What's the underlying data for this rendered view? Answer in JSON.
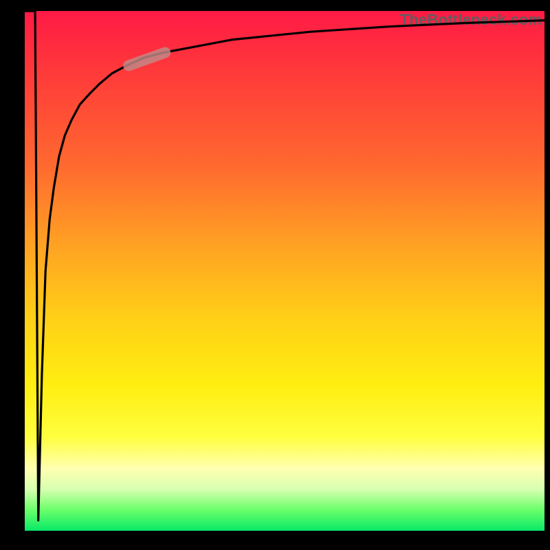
{
  "watermark": "TheBottleneck.com",
  "colors": {
    "frame": "#000000",
    "gradient_top": "#ff1a45",
    "gradient_mid": "#ffee10",
    "gradient_bottom": "#08e868",
    "curve": "#000000",
    "highlight": "#c18a88"
  },
  "chart_data": {
    "type": "line",
    "title": "",
    "xlabel": "",
    "ylabel": "",
    "xlim": [
      0,
      100
    ],
    "ylim": [
      0,
      100
    ],
    "grid": false,
    "series": [
      {
        "name": "bottleneck-curve",
        "x": [
          0,
          2.0,
          2.6,
          3.3,
          4.0,
          4.8,
          5.6,
          6.6,
          7.7,
          9.0,
          10.6,
          12.4,
          14.4,
          16.8,
          19.6,
          22.9,
          26.7,
          40,
          55,
          70,
          85,
          100
        ],
        "y": [
          100,
          100,
          2,
          30,
          50,
          60,
          66,
          72,
          76,
          79,
          82,
          84,
          86,
          88,
          89.5,
          91,
          92,
          94.5,
          96,
          97,
          97.7,
          98.2
        ]
      }
    ],
    "annotations": [
      {
        "name": "highlight-segment",
        "x": [
          20,
          27
        ],
        "y": [
          89.5,
          92
        ],
        "style": "thick-rounded",
        "color": "#c18a88"
      }
    ]
  }
}
